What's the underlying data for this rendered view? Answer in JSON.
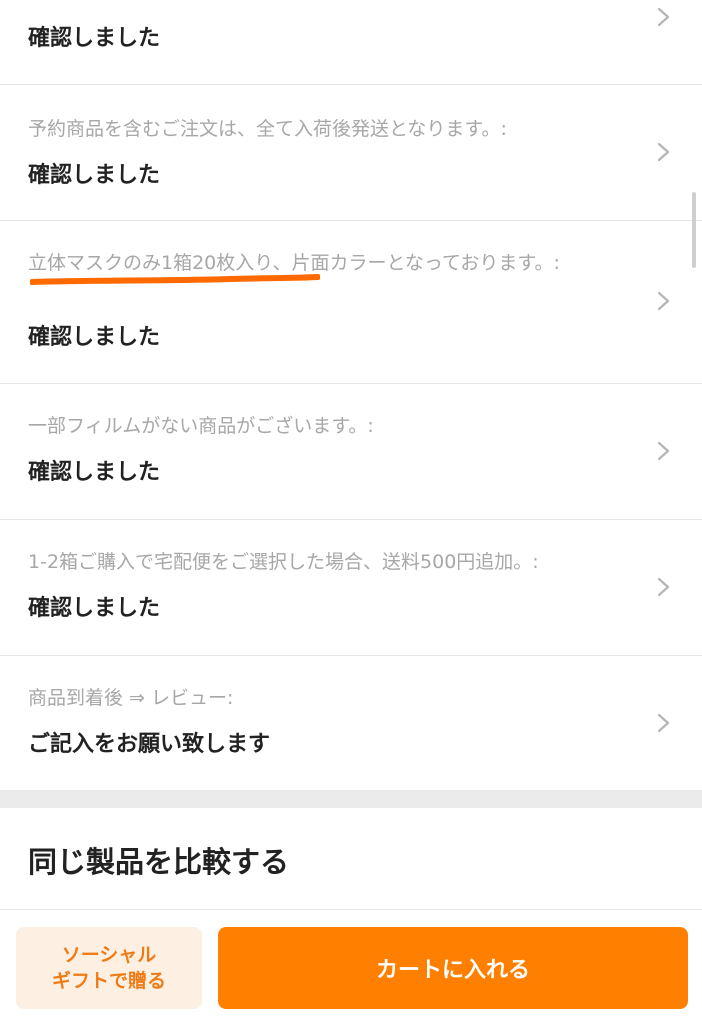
{
  "options": [
    {
      "label": "",
      "value": "確認しました"
    },
    {
      "label": "予約商品を含むご注文は、全て入荷後発送となります。:",
      "value": "確認しました"
    },
    {
      "label": "立体マスクのみ1箱20枚入り、片面カラーとなっております。:",
      "value": "確認しました"
    },
    {
      "label": "一部フィルムがない商品がございます。:",
      "value": "確認しました"
    },
    {
      "label": "1-2箱ご購入で宅配便をご選択した場合、送料500円追加。:",
      "value": "確認しました"
    },
    {
      "label": "商品到着後 ⇒ レビュー:",
      "value": "ご記入をお願い致します"
    }
  ],
  "compare": {
    "title": "同じ製品を比較する"
  },
  "bottom_bar": {
    "gift_line1": "ソーシャル",
    "gift_line2": "ギフトで贈る",
    "cart_label": "カートに入れる"
  },
  "colors": {
    "accent": "#ff8000",
    "gift_bg": "#fdf0e2",
    "gift_text": "#ef7b17",
    "highlight_underline": "#ff6a00",
    "label_text": "#a7a7a7",
    "value_text": "#222222"
  },
  "icons": {
    "row_chevron": "chevron-right-icon"
  }
}
